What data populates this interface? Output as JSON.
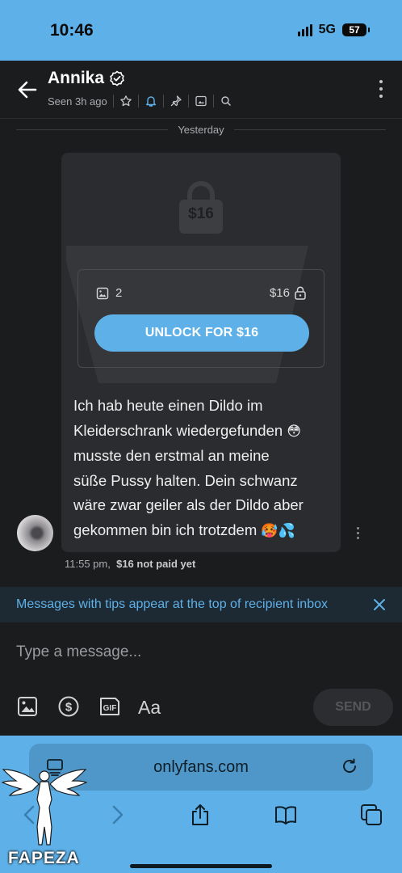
{
  "status_bar": {
    "time": "10:46",
    "network": "5G",
    "battery": "57"
  },
  "header": {
    "name": "Annika",
    "last_seen": "Seen 3h ago",
    "icons": [
      "star-icon",
      "bell-icon",
      "pin-icon",
      "image-icon",
      "search-icon"
    ]
  },
  "chat": {
    "date_divider": "Yesterday",
    "message": {
      "locked_price": "$16",
      "media_count": "2",
      "price": "$16",
      "unlock_label": "UNLOCK FOR $16",
      "text_lines": [
        "Ich hab heute einen Dildo im",
        "Kleiderschrank wiedergefunden",
        "musste den erstmal an meine",
        "süße Pussy halten. Dein schwanz",
        "wäre zwar geiler als der Dildo aber",
        "gekommen bin ich trotzdem"
      ],
      "emoji_1": "😳",
      "emoji_2": "🥵💦",
      "time": "11:55 pm,",
      "payment_status": "$16 not paid yet"
    }
  },
  "banner": {
    "text": "Messages with tips appear at the top of recipient inbox"
  },
  "composer": {
    "placeholder": "Type a message...",
    "font_label": "Aa",
    "send_label": "SEND"
  },
  "browser": {
    "url": "onlyfans.com"
  },
  "watermark": {
    "brand": "FAPEZA"
  },
  "colors": {
    "accent": "#5eb1e8",
    "background": "#1b1c1e",
    "bubble": "#2b2c2f"
  }
}
